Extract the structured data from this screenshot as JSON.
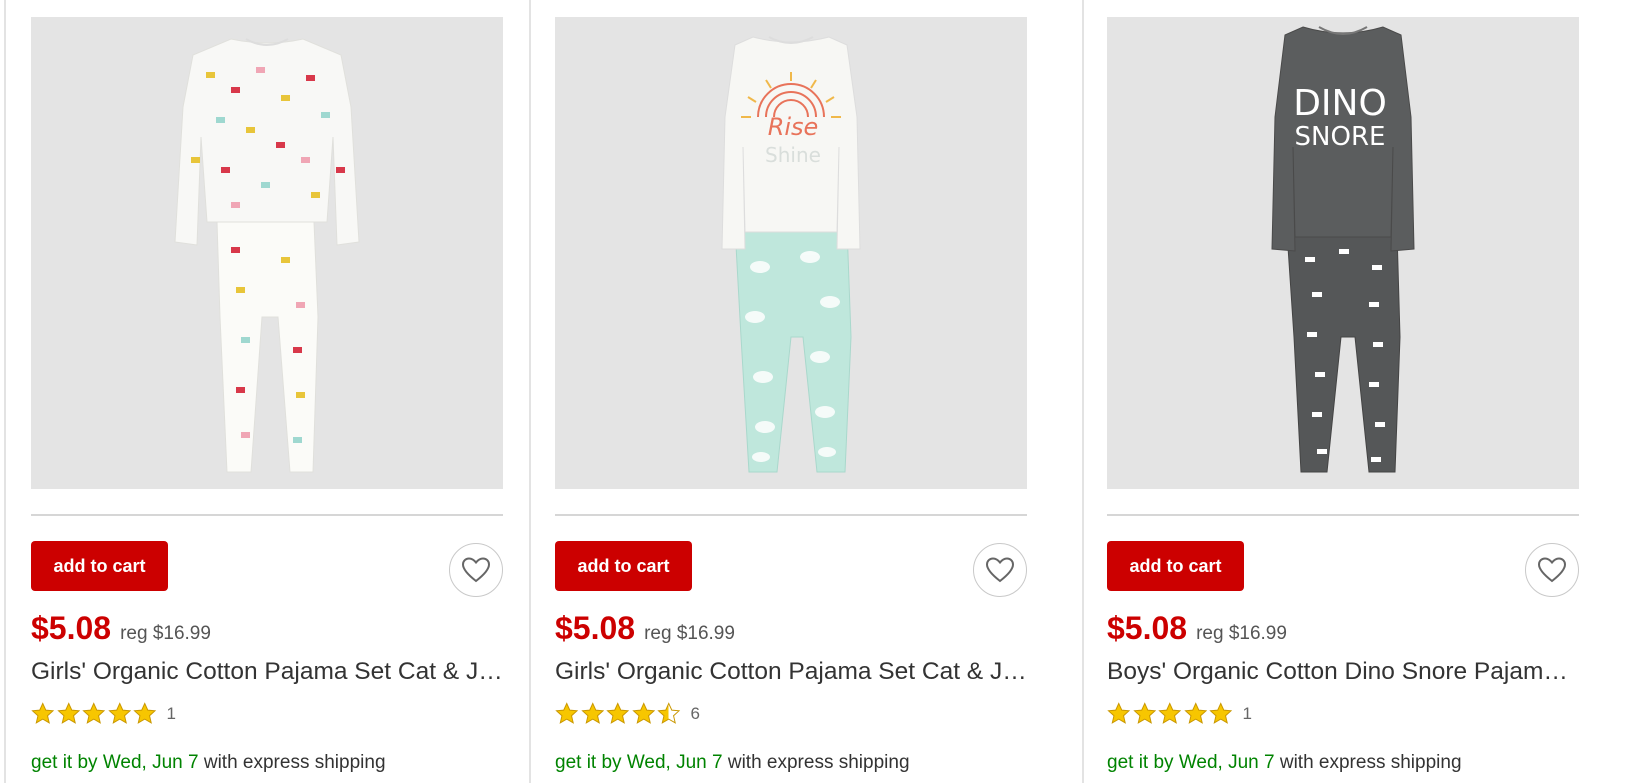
{
  "colors": {
    "accent_red": "#cc0000",
    "ship_green": "#008300",
    "star_gold": "#f7c600",
    "image_bg": "#e4e4e4"
  },
  "products": [
    {
      "image_alt_icon": "pajama-white-deer-print",
      "add_to_cart_label": "add to cart",
      "favorite_icon": "heart-outline-icon",
      "price": "$5.08",
      "reg_price": "reg $16.99",
      "title": "Girls' Organic Cotton Pajama Set Cat & Jack",
      "rating": 5,
      "review_count": "1",
      "ship_prefix": "get it by Wed, Jun 7",
      "ship_suffix": " with express shipping"
    },
    {
      "image_alt_icon": "pajama-rise-and-shine-mint-clouds",
      "add_to_cart_label": "add to cart",
      "favorite_icon": "heart-outline-icon",
      "price": "$5.08",
      "reg_price": "reg $16.99",
      "title": "Girls' Organic Cotton Pajama Set Cat & Jack",
      "rating": 4.5,
      "review_count": "6",
      "ship_prefix": "get it by Wed, Jun 7",
      "ship_suffix": " with express shipping"
    },
    {
      "image_alt_icon": "pajama-dino-snore-gray",
      "shirt_text_line1": "DINO",
      "shirt_text_line2": "SNORE",
      "add_to_cart_label": "add to cart",
      "favorite_icon": "heart-outline-icon",
      "price": "$5.08",
      "reg_price": "reg $16.99",
      "title": "Boys' Organic Cotton Dino Snore Pajama Set Cat & Jack",
      "rating": 5,
      "review_count": "1",
      "ship_prefix": "get it by Wed, Jun 7",
      "ship_suffix": " with express shipping"
    }
  ]
}
